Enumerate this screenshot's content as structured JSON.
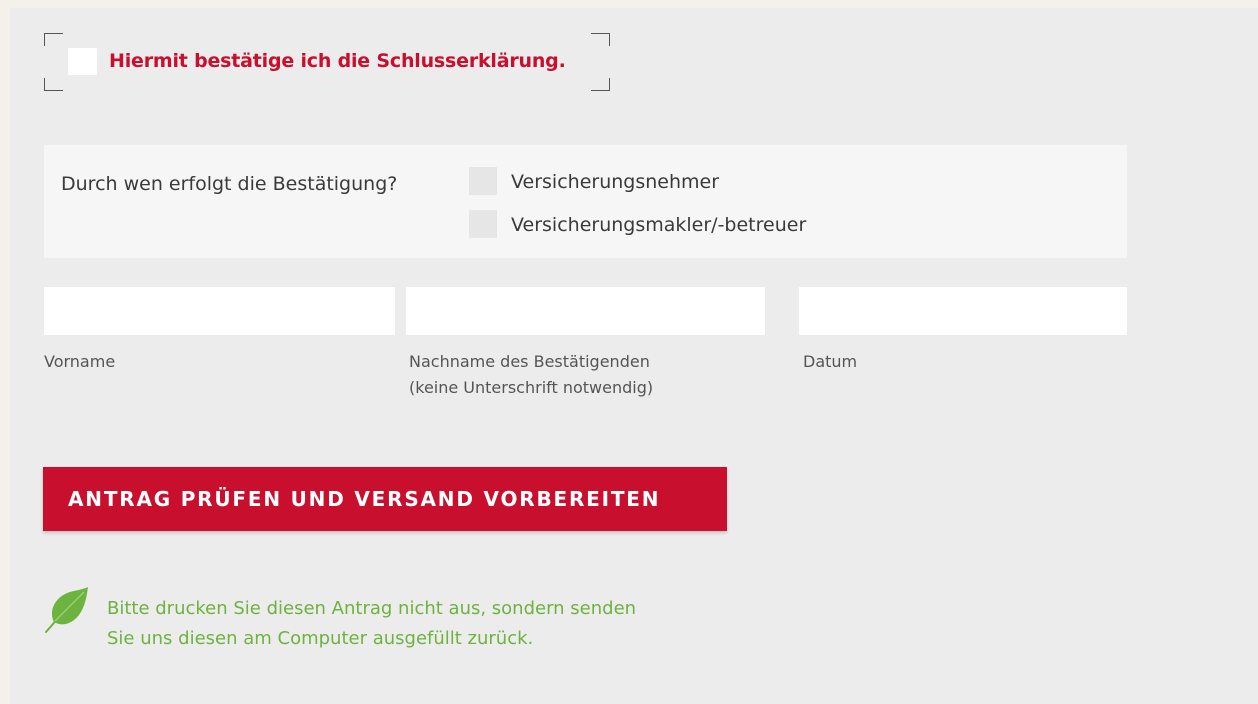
{
  "confirmation": {
    "label": "Hiermit bestätige ich die Schlusserklärung.",
    "checked": false
  },
  "confirmed_by": {
    "question": "Durch wen erfolgt die Bestätigung?",
    "options": [
      "Versicherungsnehmer",
      "Versicherungsmakler/-betreuer"
    ]
  },
  "fields": {
    "first_name": {
      "label": "Vorname",
      "value": ""
    },
    "last_name": {
      "label_line1": "Nachname des Bestätigenden",
      "label_line2": "(keine Unterschrift notwendig)",
      "value": ""
    },
    "date": {
      "label": "Datum",
      "value": ""
    }
  },
  "submit": {
    "label": "ANTRAG PRÜFEN UND VERSAND VORBEREITEN"
  },
  "eco_note": {
    "line1": "Bitte drucken Sie diesen Antrag nicht aus, sondern senden",
    "line2": "Sie uns diesen am Computer ausgefüllt zurück.",
    "icon": "leaf-icon"
  },
  "colors": {
    "accent": "#c8102e",
    "eco_green": "#6cb33f",
    "panel_bg": "#ececec",
    "page_bg": "#f4f1ea"
  }
}
